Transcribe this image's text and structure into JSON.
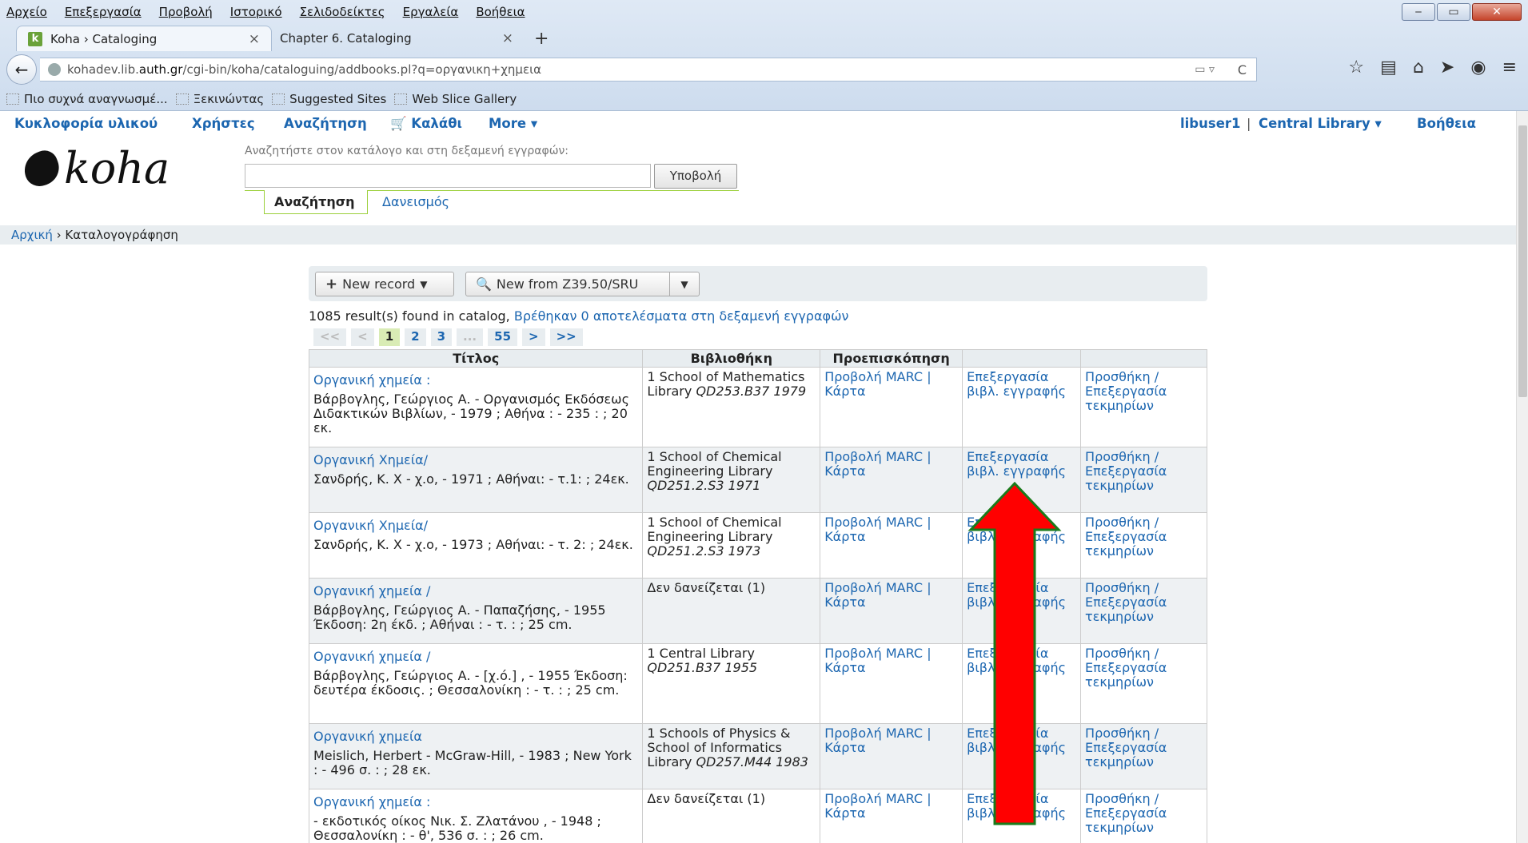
{
  "browser": {
    "menu": [
      "Αρχείο",
      "Επεξεργασία",
      "Προβολή",
      "Ιστορικό",
      "Σελιδοδείκτες",
      "Εργαλεία",
      "Βοήθεια"
    ],
    "tabs": [
      {
        "label": "Koha › Cataloging",
        "favicon": "k"
      },
      {
        "label": "Chapter 6. Cataloging"
      }
    ],
    "url_host_pre": "kohadev.lib.",
    "url_host_bold": "auth.gr",
    "url_path": "/cgi-bin/koha/cataloguing/addbooks.pl?q=οργανικη+χημεια",
    "bookmarks": [
      "Πιο συχνά αναγνωσμέ...",
      "Ξεκινώντας",
      "Suggested Sites",
      "Web Slice Gallery"
    ]
  },
  "koha": {
    "nav": {
      "circulation": "Κυκλοφορία υλικού",
      "patrons": "Χρήστες",
      "search": "Αναζήτηση",
      "cart": "Καλάθι",
      "more": "More",
      "user": "libuser1",
      "library": "Central Library",
      "help": "Βοήθεια"
    },
    "logo_text": "koha",
    "search_label": "Αναζητήστε στον κατάλογο και στη δεξαμενή εγγραφών:",
    "search_submit": "Υποβολή",
    "search_tabs": [
      "Αναζήτηση",
      "Δανεισμός"
    ],
    "breadcrumb": {
      "home": "Αρχική",
      "sep": " › ",
      "current": "Καταλογογράφηση"
    },
    "toolbar": {
      "new_record": "New record",
      "new_z3950": "New from Z39.50/SRU"
    },
    "results": {
      "count_text": "1085 result(s) found in catalog, ",
      "reservoir_link": "Βρέθηκαν 0 αποτελέσματα στη δεξαμενή εγγραφών"
    },
    "pager": [
      "<<",
      "<",
      "1",
      "2",
      "3",
      "...",
      "55",
      ">",
      ">>"
    ],
    "table": {
      "headers": [
        "Τίτλος",
        "Βιβλιοθήκη",
        "Προεπισκόπηση",
        "",
        ""
      ],
      "marc_label": "Προβολή MARC |",
      "card_label": "Κάρτα",
      "edit_biblio": "Επεξεργασία βιβλ. εγγραφής",
      "add_items": "Προσθήκη / Επεξεργασία τεκμηρίων",
      "rows": [
        {
          "title": "Οργανική χημεία :",
          "details": "Βάρβογλης, Γεώργιος Α. - Οργανισμός Εκδόσεως Διδακτικών Βιβλίων, - 1979 ; Αθήνα : - 235 : ; 20 εκ.",
          "library": "1 School of Mathematics Library",
          "callno": "QD253.B37 1979"
        },
        {
          "title": "Οργανική Χημεία/",
          "details": "Σανδρής, Κ. Χ - χ.ο, - 1971 ; Αθήναι: - τ.1: ; 24εκ.",
          "library": "1 School of Chemical Engineering Library",
          "callno": "QD251.2.S3 1971"
        },
        {
          "title": "Οργανική Χημεία/",
          "details": "Σανδρής, Κ. Χ - χ.ο, - 1973 ; Αθήναι: - τ. 2: ; 24εκ.",
          "library": "1 School of Chemical Engineering Library",
          "callno": "QD251.2.S3 1973"
        },
        {
          "title": "Οργανική χημεία /",
          "details": "Βάρβογλης, Γεώργιος Α. - Παπαζήσης, - 1955 Έκδοση: 2η έκδ. ; Αθήναι : - τ. : ; 25 cm.",
          "library": "Δεν δανείζεται (1)",
          "callno": ""
        },
        {
          "title": "Οργανική χημεία /",
          "details": "Βάρβογλης, Γεώργιος Α. - [χ.ό.] , - 1955 Έκδοση: δευτέρα έκδοσις. ; Θεσσαλονίκη : - τ. : ; 25 cm.",
          "library": "1 Central Library",
          "callno": "QD251.B37 1955"
        },
        {
          "title": "Οργανική χημεία",
          "details": "Meislich, Herbert - McGraw-Hill, - 1983 ; New York : - 496 σ. : ; 28 εκ.",
          "library": "1 Schools of Physics & School of Informatics Library",
          "callno": "QD257.M44 1983"
        },
        {
          "title": "Οργανική χημεία :",
          "details": " - εκδοτικός οίκος Νικ. Σ. Ζλατάνου , - 1948 ; Θεσσαλονίκη : - θ', 536 σ. : ; 26 cm.",
          "library": "Δεν δανείζεται (1)",
          "callno": ""
        }
      ]
    }
  },
  "annotation": {
    "arrow_color": "#ff0000",
    "arrow_outline": "#1a7a1a"
  }
}
